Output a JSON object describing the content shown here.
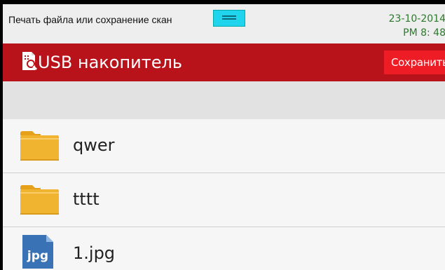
{
  "status_bar": {
    "title": "Печать файла или сохранение скан",
    "date": "23-10-2014",
    "time": "PM 8: 48"
  },
  "header": {
    "title": "USB накопитель",
    "save_label": "Сохранить",
    "color": "#b8121a",
    "save_color": "#ee1c24"
  },
  "files": [
    {
      "name": "qwer",
      "type": "folder",
      "icon": "folder-icon"
    },
    {
      "name": "tttt",
      "type": "folder",
      "icon": "folder-icon"
    },
    {
      "name": "1.jpg",
      "type": "jpg",
      "icon": "jpg-file-icon",
      "icon_text": "jpg"
    }
  ]
}
